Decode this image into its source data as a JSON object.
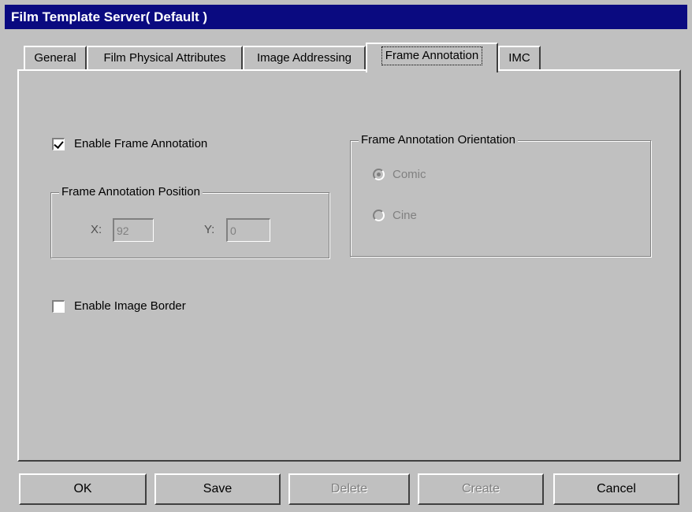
{
  "window": {
    "title": "Film Template Server( Default )"
  },
  "tabs": [
    {
      "label": "General",
      "active": false
    },
    {
      "label": "Film Physical Attributes",
      "active": false
    },
    {
      "label": "Image Addressing",
      "active": false
    },
    {
      "label": "Frame Annotation",
      "active": true
    },
    {
      "label": "IMC",
      "active": false
    }
  ],
  "frame_annotation": {
    "enable_label": "Enable Frame Annotation",
    "enable_checked": true,
    "position_group": {
      "label": "Frame Annotation Position",
      "x_label": "X:",
      "x_value": "92",
      "y_label": "Y:",
      "y_value": "0"
    },
    "orientation_group": {
      "label": "Frame Annotation Orientation",
      "options": [
        {
          "label": "Comic",
          "selected": true
        },
        {
          "label": "Cine",
          "selected": false
        }
      ],
      "disabled": true
    },
    "image_border_label": "Enable Image Border",
    "image_border_checked": false
  },
  "buttons": {
    "ok": {
      "label": "OK",
      "disabled": false
    },
    "save": {
      "label": "Save",
      "disabled": false
    },
    "delete": {
      "label": "Delete",
      "disabled": true
    },
    "create": {
      "label": "Create",
      "disabled": true
    },
    "cancel": {
      "label": "Cancel",
      "disabled": false
    }
  },
  "colors": {
    "title_bar": "#0a0a80",
    "face": "#c0c0c0",
    "disabled_text": "#808080"
  }
}
